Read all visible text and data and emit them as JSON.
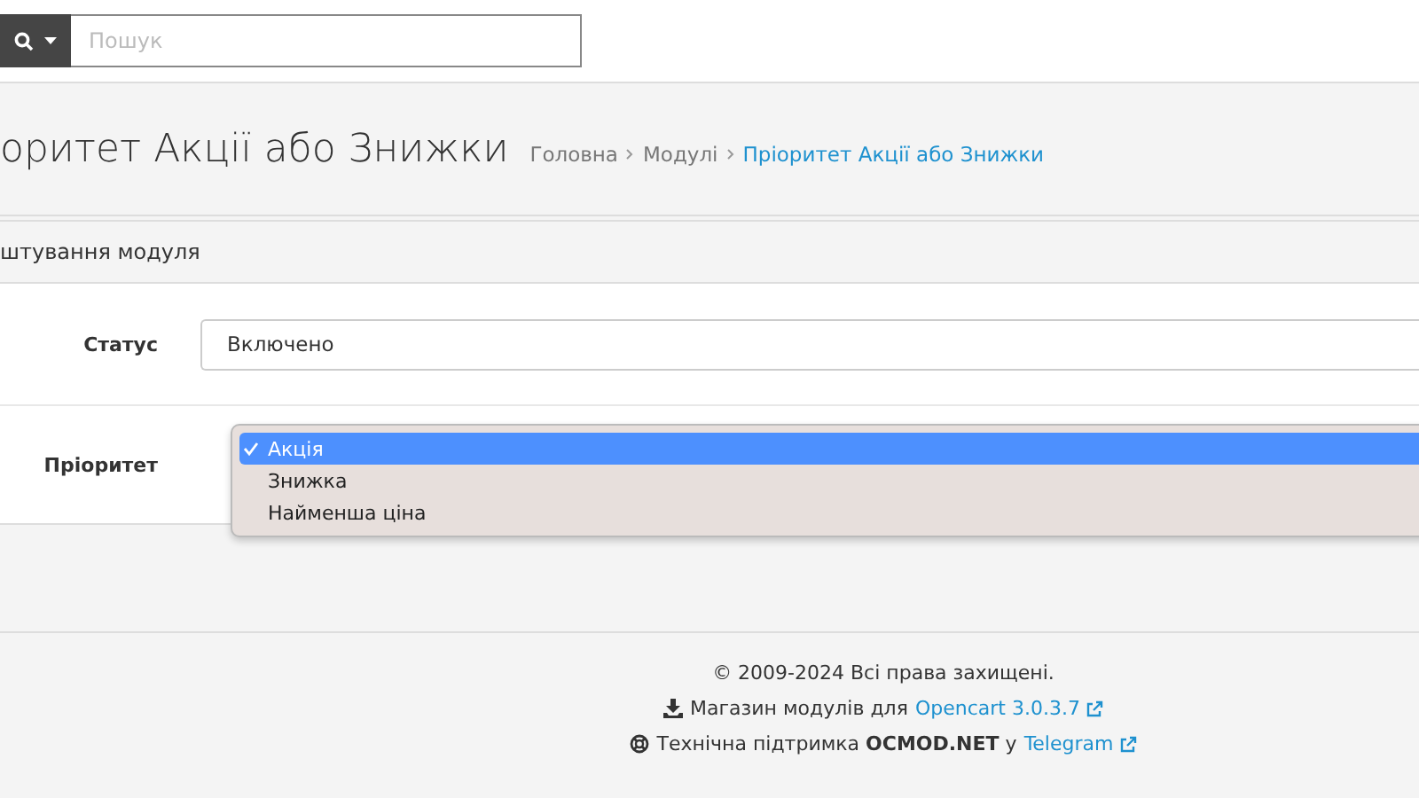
{
  "header": {
    "search": {
      "placeholder": "Пошук"
    }
  },
  "page_header": {
    "title": "оритет Акції або Знижки",
    "breadcrumbs": [
      {
        "label": "Головна",
        "active": false
      },
      {
        "label": "Модулі",
        "active": false
      },
      {
        "label": "Пріоритет Акції або Знижки",
        "active": true
      }
    ]
  },
  "panel": {
    "heading": "штування модуля",
    "fields": [
      {
        "label": "Статус",
        "value": "Включено",
        "open": false
      },
      {
        "label": "Пріоритет",
        "open": true,
        "options": [
          {
            "label": "Акція",
            "selected": true
          },
          {
            "label": "Знижка",
            "selected": false
          },
          {
            "label": "Найменша ціна",
            "selected": false
          }
        ]
      }
    ]
  },
  "footer": {
    "copyright": "© 2009-2024 Всі права захищені.",
    "store": {
      "text": "Магазин модулів для",
      "link": "Opencart 3.0.3.7"
    },
    "support": {
      "text": "Технічна підтримка **OCMOD.NET** у",
      "link": "Telegram"
    }
  }
}
